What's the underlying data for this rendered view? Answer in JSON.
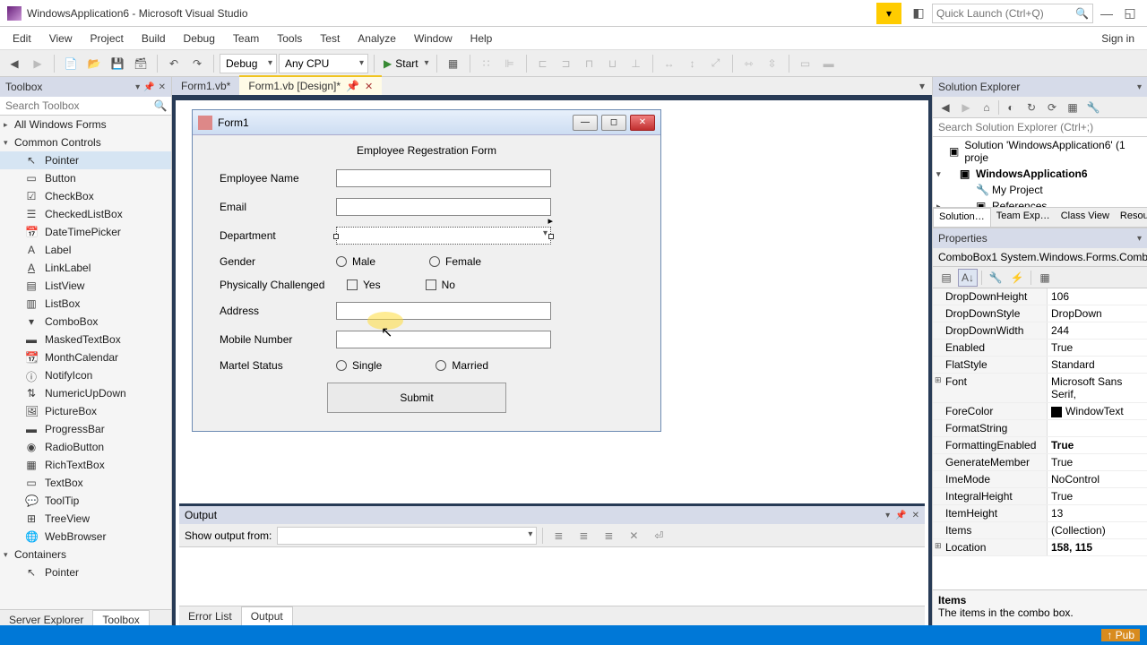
{
  "titlebar": {
    "title": "WindowsApplication6 - Microsoft Visual Studio",
    "quick_launch": "Quick Launch (Ctrl+Q)"
  },
  "menubar": {
    "items": [
      "Edit",
      "View",
      "Project",
      "Build",
      "Debug",
      "Team",
      "Tools",
      "Test",
      "Analyze",
      "Window",
      "Help"
    ],
    "signin": "Sign in"
  },
  "toolbar": {
    "config": "Debug",
    "platform": "Any CPU",
    "start": "Start"
  },
  "toolbox": {
    "title": "Toolbox",
    "search": "Search Toolbox",
    "cat1": "All Windows Forms",
    "cat2": "Common Controls",
    "cat3": "Containers",
    "items": [
      "Pointer",
      "Button",
      "CheckBox",
      "CheckedListBox",
      "DateTimePicker",
      "Label",
      "LinkLabel",
      "ListView",
      "ListBox",
      "ComboBox",
      "MaskedTextBox",
      "MonthCalendar",
      "NotifyIcon",
      "NumericUpDown",
      "PictureBox",
      "ProgressBar",
      "RadioButton",
      "RichTextBox",
      "TextBox",
      "ToolTip",
      "TreeView",
      "WebBrowser"
    ],
    "items2": [
      "Pointer"
    ]
  },
  "bottom_left": {
    "tabs": [
      "Server Explorer",
      "Toolbox"
    ]
  },
  "doc_tabs": {
    "tab1": "Form1.vb*",
    "tab2": "Form1.vb [Design]*"
  },
  "form": {
    "title": "Form1",
    "heading": "Employee Regestration Form",
    "labels": {
      "name": "Employee Name",
      "email": "Email",
      "dept": "Department",
      "gender": "Gender",
      "phys": "Physically Challenged",
      "addr": "Address",
      "mobile": "Mobile Number",
      "marital": "Martel Status"
    },
    "gender": {
      "male": "Male",
      "female": "Female"
    },
    "phys": {
      "yes": "Yes",
      "no": "No"
    },
    "marital": {
      "single": "Single",
      "married": "Married"
    },
    "submit": "Submit"
  },
  "output": {
    "title": "Output",
    "show_from": "Show output from:"
  },
  "bottom_center": {
    "tabs": [
      "Error List",
      "Output"
    ]
  },
  "solution": {
    "title": "Solution Explorer",
    "search": "Search Solution Explorer (Ctrl+;)",
    "root": "Solution 'WindowsApplication6' (1 proje",
    "proj": "WindowsApplication6",
    "myproj": "My Project",
    "refs": "References",
    "tabs": [
      "Solution…",
      "Team Exp…",
      "Class View",
      "Resour"
    ]
  },
  "properties": {
    "title": "Properties",
    "object": "ComboBox1  System.Windows.Forms.Comb",
    "rows": [
      {
        "n": "DropDownHeight",
        "v": "106"
      },
      {
        "n": "DropDownStyle",
        "v": "DropDown"
      },
      {
        "n": "DropDownWidth",
        "v": "244"
      },
      {
        "n": "Enabled",
        "v": "True"
      },
      {
        "n": "FlatStyle",
        "v": "Standard"
      },
      {
        "n": "Font",
        "v": "Microsoft Sans Serif,",
        "exp": "⊞"
      },
      {
        "n": "ForeColor",
        "v": "WindowText",
        "swatch": true
      },
      {
        "n": "FormatString",
        "v": ""
      },
      {
        "n": "FormattingEnabled",
        "v": "True",
        "bold": true
      },
      {
        "n": "GenerateMember",
        "v": "True"
      },
      {
        "n": "ImeMode",
        "v": "NoControl"
      },
      {
        "n": "IntegralHeight",
        "v": "True"
      },
      {
        "n": "ItemHeight",
        "v": "13"
      },
      {
        "n": "Items",
        "v": "(Collection)"
      },
      {
        "n": "Location",
        "v": "158, 115",
        "exp": "⊞",
        "bold": true
      }
    ],
    "desc_name": "Items",
    "desc_text": "The items in the combo box."
  },
  "statusbar": {
    "pub": "↑ Pub"
  }
}
